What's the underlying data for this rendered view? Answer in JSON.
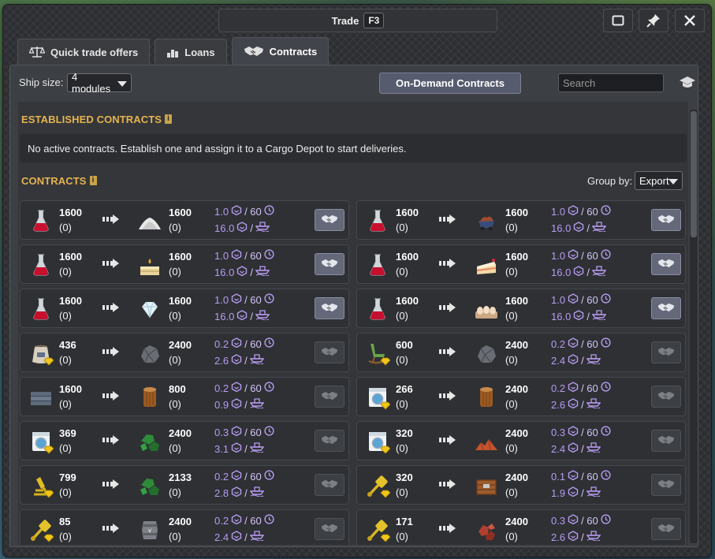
{
  "window": {
    "title": "Trade",
    "hotkey": "F3"
  },
  "tabs": [
    {
      "label": "Quick trade offers",
      "icon": "scales-icon",
      "active": false
    },
    {
      "label": "Loans",
      "icon": "coins-icon",
      "active": false
    },
    {
      "label": "Contracts",
      "icon": "handshake-icon",
      "active": true
    }
  ],
  "toolbar": {
    "ship_size_label": "Ship size:",
    "ship_size_value": "4 modules",
    "on_demand_label": "On-Demand Contracts",
    "search_placeholder": "Search"
  },
  "established": {
    "title": "ESTABLISHED CONTRACTS",
    "info": "i",
    "empty_message": "No active contracts. Establish one and assign it to a Cargo Depot to start deliveries."
  },
  "contracts": {
    "title": "CONTRACTS",
    "info": "i",
    "group_by_label": "Group by:",
    "group_by_value": "Export"
  },
  "colors": {
    "section_title": "#e6b34e",
    "rate_text": "#b79cf0",
    "accept_enabled": "#646878",
    "accept_disabled": "#3f4247"
  },
  "rows": [
    [
      {
        "export_icon": "flask-icon",
        "export_qty": "1600",
        "export_held": "(0)",
        "import_icon": "powder-icon",
        "import_qty": "1600",
        "import_held": "(0)",
        "rate_top": "1.0",
        "rate_top_max": "/ 60",
        "rate_bottom": "16.0",
        "rate_bottom_sep": "/",
        "enabled": true
      },
      {
        "export_icon": "flask-icon",
        "export_qty": "1600",
        "export_held": "(0)",
        "import_icon": "minecart-icon",
        "import_qty": "1600",
        "import_held": "(0)",
        "rate_top": "1.0",
        "rate_top_max": "/ 60",
        "rate_bottom": "16.0",
        "rate_bottom_sep": "/",
        "enabled": true
      }
    ],
    [
      {
        "export_icon": "flask-icon",
        "export_qty": "1600",
        "export_held": "(0)",
        "import_icon": "candle-icon",
        "import_qty": "1600",
        "import_held": "(0)",
        "rate_top": "1.0",
        "rate_top_max": "/ 60",
        "rate_bottom": "16.0",
        "rate_bottom_sep": "/",
        "enabled": true
      },
      {
        "export_icon": "flask-icon",
        "export_qty": "1600",
        "export_held": "(0)",
        "import_icon": "cake-icon",
        "import_qty": "1600",
        "import_held": "(0)",
        "rate_top": "1.0",
        "rate_top_max": "/ 60",
        "rate_bottom": "16.0",
        "rate_bottom_sep": "/",
        "enabled": true
      }
    ],
    [
      {
        "export_icon": "flask-icon",
        "export_qty": "1600",
        "export_held": "(0)",
        "import_icon": "diamond-icon",
        "import_qty": "1600",
        "import_held": "(0)",
        "rate_top": "1.0",
        "rate_top_max": "/ 60",
        "rate_bottom": "16.0",
        "rate_bottom_sep": "/",
        "enabled": true
      },
      {
        "export_icon": "flask-icon",
        "export_qty": "1600",
        "export_held": "(0)",
        "import_icon": "eggs-icon",
        "import_qty": "1600",
        "import_held": "(0)",
        "rate_top": "1.0",
        "rate_top_max": "/ 60",
        "rate_bottom": "16.0",
        "rate_bottom_sep": "/",
        "enabled": true
      }
    ],
    [
      {
        "export_icon": "sack-icon",
        "export_qty": "436",
        "export_held": "(0)",
        "import_icon": "rock-icon",
        "import_qty": "2400",
        "import_held": "(0)",
        "rate_top": "0.2",
        "rate_top_max": "/ 60",
        "rate_bottom": "2.6",
        "rate_bottom_sep": "/",
        "enabled": false
      },
      {
        "export_icon": "chair-icon",
        "export_qty": "600",
        "export_held": "(0)",
        "import_icon": "rock-icon",
        "import_qty": "2400",
        "import_held": "(0)",
        "rate_top": "0.2",
        "rate_top_max": "/ 60",
        "rate_bottom": "2.4",
        "rate_bottom_sep": "/",
        "enabled": false
      }
    ],
    [
      {
        "export_icon": "planks-icon",
        "export_qty": "1600",
        "export_held": "(0)",
        "import_icon": "log-icon",
        "import_qty": "800",
        "import_held": "(0)",
        "rate_top": "0.2",
        "rate_top_max": "/ 60",
        "rate_bottom": "0.9",
        "rate_bottom_sep": "/",
        "enabled": false
      },
      {
        "export_icon": "washer-icon",
        "export_qty": "266",
        "export_held": "(0)",
        "import_icon": "log-icon",
        "import_qty": "2400",
        "import_held": "(0)",
        "rate_top": "0.2",
        "rate_top_max": "/ 60",
        "rate_bottom": "2.6",
        "rate_bottom_sep": "/",
        "enabled": false
      }
    ],
    [
      {
        "export_icon": "washer-icon",
        "export_qty": "369",
        "export_held": "(0)",
        "import_icon": "ore-icon",
        "import_qty": "2400",
        "import_held": "(0)",
        "rate_top": "0.3",
        "rate_top_max": "/ 60",
        "rate_bottom": "3.1",
        "rate_bottom_sep": "/",
        "enabled": false
      },
      {
        "export_icon": "washer-icon",
        "export_qty": "320",
        "export_held": "(0)",
        "import_icon": "clay-icon",
        "import_qty": "2400",
        "import_held": "(0)",
        "rate_top": "0.3",
        "rate_top_max": "/ 60",
        "rate_bottom": "2.4",
        "rate_bottom_sep": "/",
        "enabled": false
      }
    ],
    [
      {
        "export_icon": "microscope-icon",
        "export_qty": "799",
        "export_held": "(0)",
        "import_icon": "ore-icon",
        "import_qty": "2133",
        "import_held": "(0)",
        "rate_top": "0.2",
        "rate_top_max": "/ 60",
        "rate_bottom": "2.8",
        "rate_bottom_sep": "/",
        "enabled": false
      },
      {
        "export_icon": "piston-icon",
        "export_qty": "320",
        "export_held": "(0)",
        "import_icon": "crate-icon",
        "import_qty": "2400",
        "import_held": "(0)",
        "rate_top": "0.1",
        "rate_top_max": "/ 60",
        "rate_bottom": "1.9",
        "rate_bottom_sep": "/",
        "enabled": false
      }
    ],
    [
      {
        "export_icon": "piston-icon",
        "export_qty": "85",
        "export_held": "(0)",
        "import_icon": "barrel-icon",
        "import_qty": "2400",
        "import_held": "(0)",
        "rate_top": "0.2",
        "rate_top_max": "/ 60",
        "rate_bottom": "2.4",
        "rate_bottom_sep": "/",
        "enabled": false
      },
      {
        "export_icon": "piston-icon",
        "export_qty": "171",
        "export_held": "(0)",
        "import_icon": "brick-ore-icon",
        "import_qty": "2400",
        "import_held": "(0)",
        "rate_top": "0.3",
        "rate_top_max": "/ 60",
        "rate_bottom": "2.6",
        "rate_bottom_sep": "/",
        "enabled": false
      }
    ]
  ]
}
